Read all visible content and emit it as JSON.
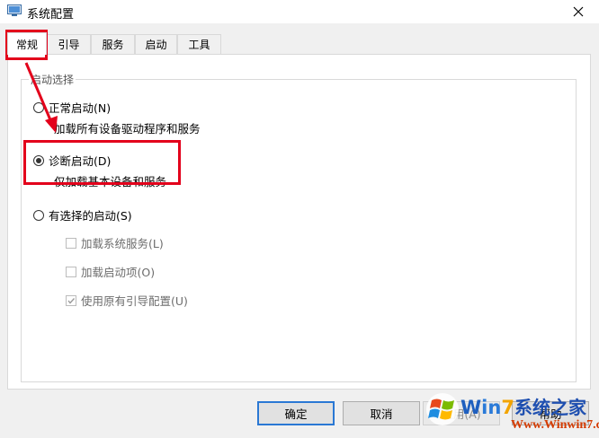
{
  "window": {
    "title": "系统配置",
    "app_icon": "system-config-icon",
    "close_icon": "close-icon"
  },
  "tabs": [
    {
      "label": "常规",
      "active": true
    },
    {
      "label": "引导",
      "active": false
    },
    {
      "label": "服务",
      "active": false
    },
    {
      "label": "启动",
      "active": false
    },
    {
      "label": "工具",
      "active": false
    }
  ],
  "startup_group": {
    "legend": "启动选择",
    "normal": {
      "label": "正常启动(N)",
      "description": "加载所有设备驱动程序和服务",
      "checked": false
    },
    "diagnostic": {
      "label": "诊断启动(D)",
      "description": "仅加载基本设备和服务",
      "checked": true
    },
    "selective": {
      "label": "有选择的启动(S)",
      "checked": false,
      "options": [
        {
          "label": "加载系统服务(L)",
          "checked": false
        },
        {
          "label": "加载启动项(O)",
          "checked": false
        },
        {
          "label": "使用原有引导配置(U)",
          "checked": true
        }
      ]
    }
  },
  "buttons": {
    "ok": "确定",
    "cancel": "取消",
    "apply": "应用(A)",
    "help": "帮助"
  },
  "annotation": {
    "color": "#e3001b"
  },
  "watermark": {
    "brand_w": "W",
    "brand_in": "in",
    "brand_7": "7",
    "brand_cn": "系统之家",
    "url": "Www.Winwin7.com"
  },
  "colors": {
    "default_button_border": "#2a78d4",
    "panel_bg": "#ffffff",
    "window_bg": "#f0f0f0"
  }
}
